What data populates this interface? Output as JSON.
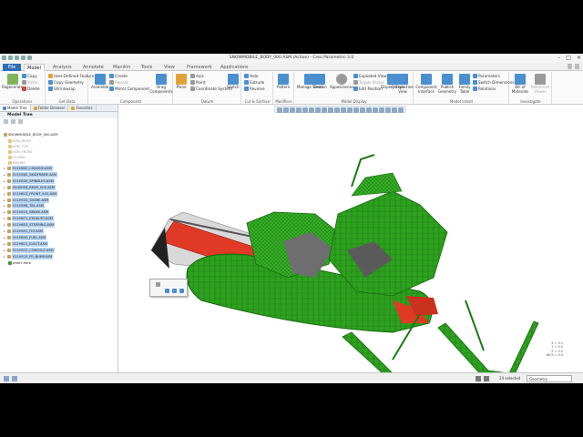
{
  "window": {
    "title": "SNOWMOBILE_BODY_000.ASM (Active) - Creo Parametric 3.0"
  },
  "tabs": [
    "File",
    "Model",
    "Analysis",
    "Annotate",
    "Manikin",
    "Tools",
    "View",
    "Framework",
    "Applications"
  ],
  "ribbon": {
    "groups": [
      {
        "label": "Operations",
        "items": [
          "Regenerate",
          "Copy",
          "Paste",
          "Delete"
        ]
      },
      {
        "label": "Get Data",
        "items": [
          "User-Defined Feature",
          "Copy Geometry",
          "Shrinkwrap"
        ]
      },
      {
        "label": "Component",
        "items": [
          "Assemble",
          "Create",
          "Repeat",
          "Mirror Component",
          "Drag Components"
        ]
      },
      {
        "label": "Datum",
        "items": [
          "Plane",
          "Axis",
          "Point",
          "Coordinate System",
          "Sketch"
        ]
      },
      {
        "label": "Cut & Surface",
        "items": [
          "Hole",
          "Extrude",
          "Revolve"
        ]
      },
      {
        "label": "Modifiers",
        "items": [
          "Pattern"
        ]
      },
      {
        "label": "Model Display",
        "items": [
          "Manage Views",
          "Section",
          "Appearances",
          "Exploded View",
          "Toggle Status",
          "Edit Position",
          "Display Style",
          "Perspective View"
        ]
      },
      {
        "label": "Model Intent",
        "items": [
          "Component Interface",
          "Publish Geometry",
          "Family Table",
          "Parameters",
          "Switch Dimensions",
          "Relations"
        ]
      },
      {
        "label": "Investigate",
        "items": [
          "Bill of Materials",
          "Reference Viewer"
        ]
      }
    ]
  },
  "panel": {
    "tabs": [
      "Model Tree",
      "Folder Browser",
      "Favorites"
    ],
    "title": "Model Tree",
    "root": "SNOWMOBILE_BODY_000.ASM",
    "datums": [
      "ASM_RIGHT",
      "ASM_TOP",
      "ASM_FRONT",
      "GLOBAL",
      "ENGINE"
    ],
    "components": [
      "011H600_CHASSIS.ASM",
      "011H562_SKIDFRAME.ASM",
      "011H549_SPINDLES.ASM",
      "0440H56_REAR_SUS.ASM",
      "011H613_FRONT_SUS.ASM",
      "011H533_SHARE.ASM",
      "011H598_TBL.ASM",
      "011H512_BRAKE.ASM",
      "011H671_EXHAUST.ASM",
      "011H653_STEERING.ASM",
      "011H491_FIO.ASM",
      "011H630_FUEL.ASM",
      "011H611_ELECT.ASM",
      "011H513_CONSOLE.ASM",
      "011H515_FR_BUMP.ASM"
    ],
    "insert_here": "Insert Here"
  },
  "coords": [
    "X = 0.1",
    "Y = 0.0",
    "Z = 0.0",
    "WCS = 0.0"
  ],
  "status": {
    "selected": "24 selected",
    "filter": "Geometry"
  },
  "colors": {
    "accent": "#2f6fb5",
    "model_green": "#2ea21f",
    "model_red": "#c8321e"
  }
}
